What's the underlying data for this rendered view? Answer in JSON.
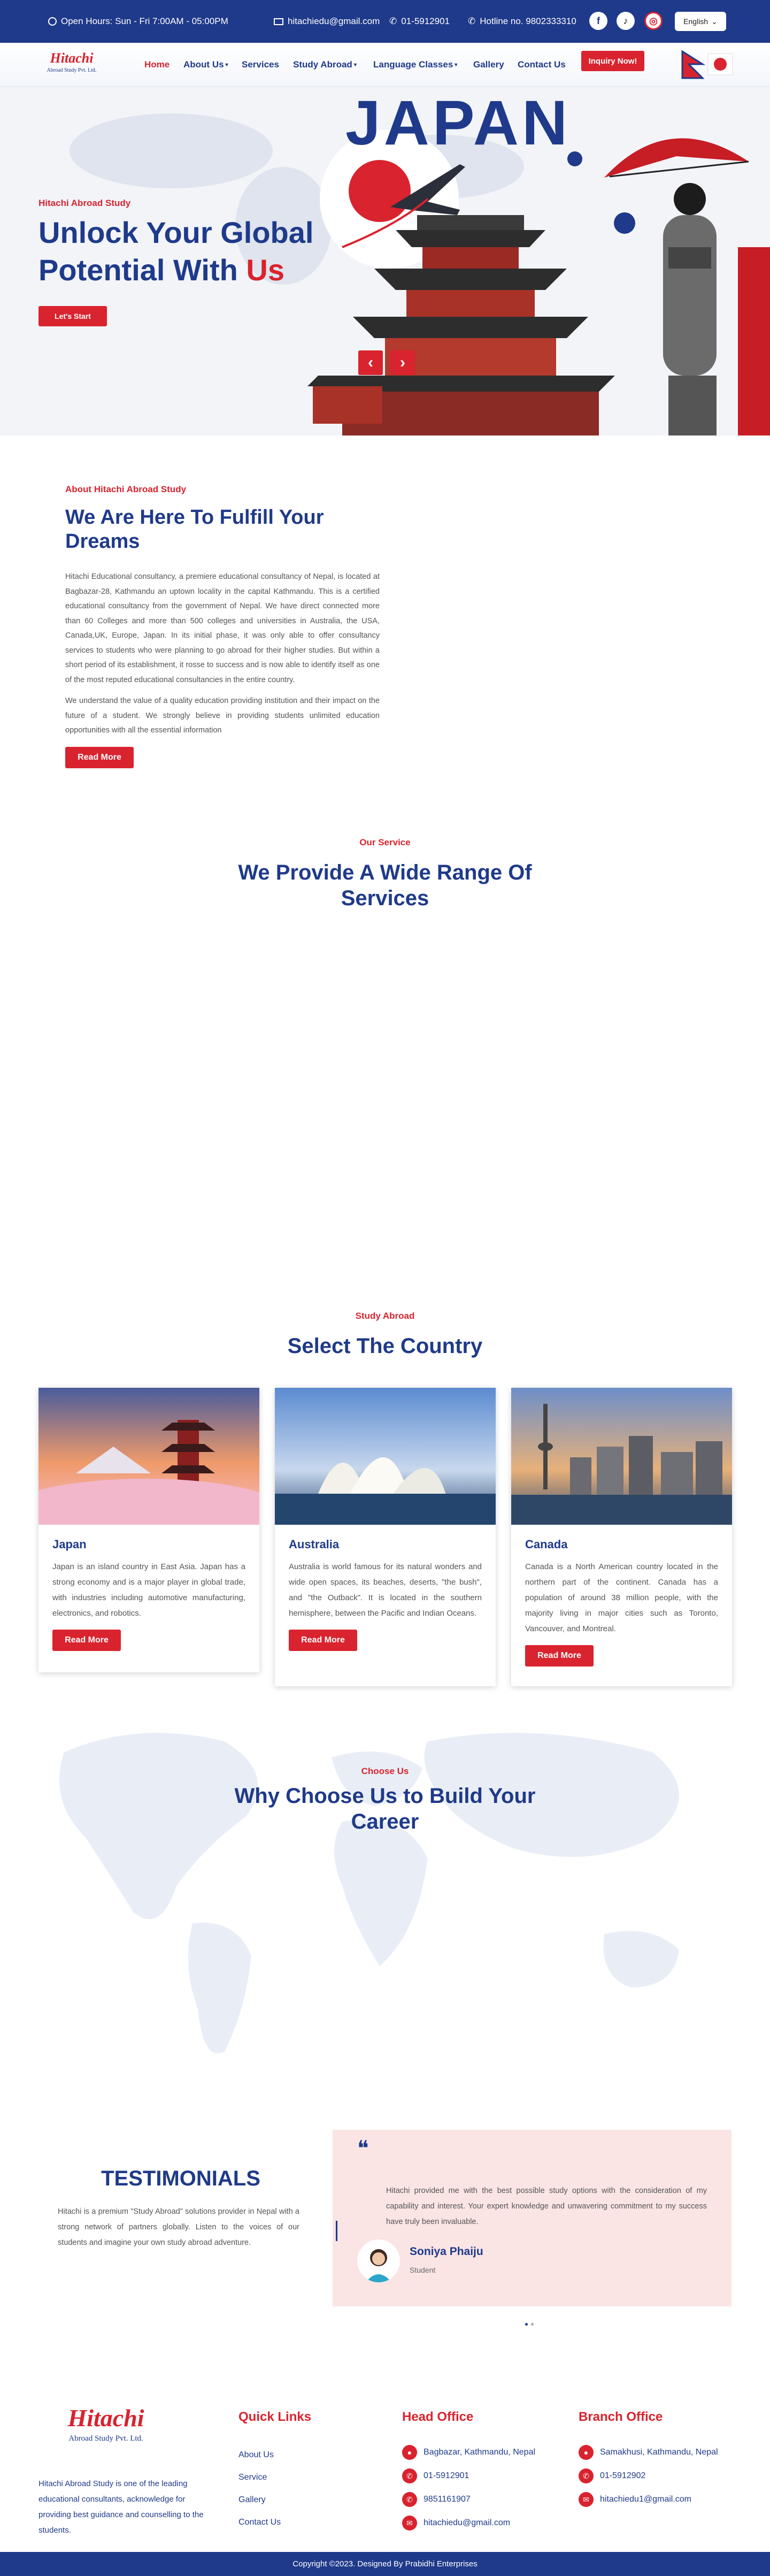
{
  "topbar": {
    "hours": "Open Hours: Sun - Fri 7:00AM - 05:00PM",
    "email": "hitachiedu@gmail.com",
    "phone": "01-5912901",
    "hotline": "Hotline no. 9802333310",
    "social": [
      "facebook-icon",
      "tiktok-icon",
      "instagram-icon"
    ],
    "language": "English"
  },
  "brand": {
    "logo_text": "Hitachi",
    "logo_sub": "Abroad Study Pvt. Ltd."
  },
  "nav": {
    "items": [
      "Home",
      "About Us",
      "Services",
      "Study Abroad",
      "Language Classes",
      "Gallery",
      "Contact Us"
    ],
    "inquiry": "Inquiry Now!"
  },
  "hero": {
    "kicker": "Hitachi Abroad Study",
    "title_line1": "Unlock Your Global",
    "title_line2a": "Potential With ",
    "title_line2b": "Us",
    "cta": "Let's Start",
    "banner_word": "JAPAN",
    "prev": "‹",
    "next": "›"
  },
  "about": {
    "kicker": "About Hitachi Abroad Study",
    "title": "We Are Here To Fulfill Your Dreams",
    "para1": "Hitachi Educational consultancy, a premiere educational consultancy of Nepal, is located at Bagbazar-28, Kathmandu an uptown locality in the capital Kathmandu. This is a certified educational consultancy from the government of Nepal. We have direct connected more than 60 Colleges and more than 500 colleges and universities in Australia, the USA, Canada,UK, Europe, Japan. In its initial phase, it was only able to offer consultancy services to students who were planning to go abroad for their higher studies. But within a short period of its establishment, it rosse to success and is now able to identify itself as one of the most reputed educational consultancies in the entire country.",
    "para2": "We understand the value of a quality education providing institution and their impact on the future of a student. We strongly believe in providing students unlimited education opportunities with all the essential information",
    "cta": "Read More"
  },
  "services": {
    "kicker": "Our Service",
    "title": "We Provide A Wide Range Of Services"
  },
  "countries": {
    "kicker": "Study Abroad",
    "title": "Select The Country",
    "items": [
      {
        "name": "Japan",
        "desc": "Japan is an island country in East Asia. Japan has a strong economy and is a major player in global trade, with industries including automotive manufacturing, electronics, and robotics.",
        "cta": "Read More"
      },
      {
        "name": "Australia",
        "desc": "Australia is world famous for its natural wonders and wide open spaces, its beaches, deserts, \"the bush\", and \"the Outback\". It is located in the southern hemisphere, between the Pacific and Indian Oceans.",
        "cta": "Read More"
      },
      {
        "name": "Canada",
        "desc": "Canada is a North American country located in the northern part of the continent. Canada has a population of around 38 million people, with the majority living in major cities such as Toronto, Vancouver, and Montreal.",
        "cta": "Read More"
      }
    ]
  },
  "why": {
    "kicker": "Choose Us",
    "title": "Why Choose Us to Build Your Career"
  },
  "testimonials": {
    "title": "TESTIMONIALS",
    "intro": "Hitachi is a premium \"Study Abroad\" solutions provider in Nepal with a strong network of partners globally. Listen to the voices of our students and imagine your own study abroad adventure.",
    "quote_mark": "❝",
    "quote": "Hitachi provided me with the best possible study options with the consideration of my capability and interest. Your expert knowledge and unwavering commitment to my success have truly been invaluable.",
    "name": "Soniya Phaiju",
    "role": "Student"
  },
  "footer": {
    "about": "Hitachi Abroad Study is one of the leading educational consultants, acknowledge for providing best guidance and counselling to the students.",
    "quick_links_title": "Quick Links",
    "quick_links": [
      "About Us",
      "Service",
      "Gallery",
      "Contact Us"
    ],
    "head_title": "Head Office",
    "head": [
      "Bagbazar, Kathmandu, Nepal",
      "01-5912901",
      "9851161907",
      "hitachiedu@gmail.com"
    ],
    "branch_title": "Branch Office",
    "branch": [
      "Samakhusi, Kathmandu, Nepal",
      "01-5912902",
      "hitachiedu1@gmail.com"
    ],
    "copyright": "Copyright ©2023. Designed By Prabidhi Enterprises"
  },
  "colors": {
    "navy": "#1f3a8a",
    "red": "#d9232e"
  }
}
